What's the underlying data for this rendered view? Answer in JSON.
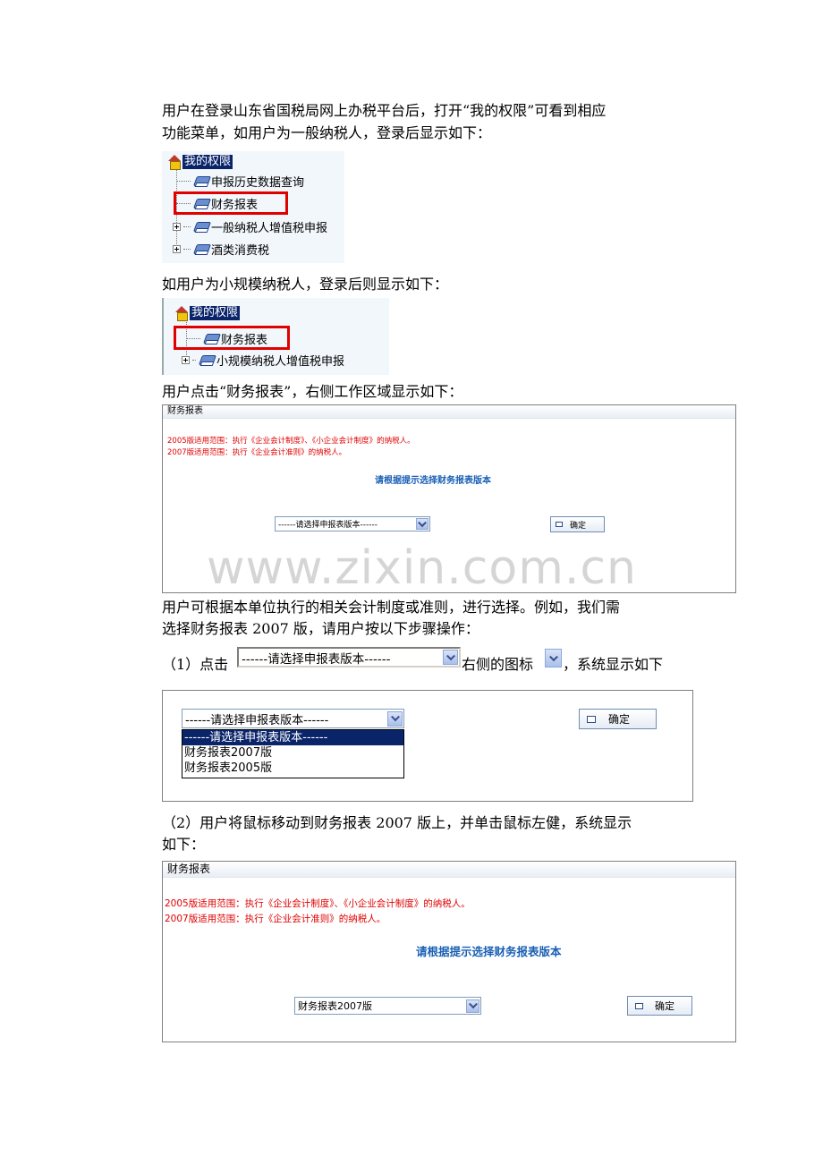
{
  "text": {
    "p1_line1": "用户在登录山东省国税局网上办税平台后，打开“我的权限”可看到相应",
    "p1_line2": "功能菜单，如用户为一般纳税人，登录后显示如下：",
    "p2": "如用户为小规模纳税人，登录后则显示如下：",
    "p3": "用户点击“财务报表”，右侧工作区域显示如下：",
    "p4_line1": "用户可根据本单位执行的相关会计制度或准则，进行选择。例如，我们需",
    "p4_line2": "选择财务报表 2007 版，请用户按以下步骤操作：",
    "step1_prefix": "（1）点击",
    "step1_middle": "右侧的图标",
    "step1_suffix": "，系统显示如下",
    "step2_line1": "（2）用户将鼠标移动到财务报表 2007 版上，并单击鼠标左健，系统显示",
    "step2_line2": "如下："
  },
  "tree1": {
    "root": "我的权限",
    "items": [
      "申报历史数据查询",
      "财务报表",
      "一般纳税人增值税申报",
      "酒类消费税"
    ]
  },
  "tree2": {
    "root": "我的权限",
    "items": [
      "财务报表",
      "小规模纳税人增值税申报"
    ]
  },
  "panel": {
    "title": "财务报表",
    "line_2005": "2005版适用范围：执行《企业会计制度》、《小企业会计制度》的纳税人。",
    "line_2007": "2007版适用范围：执行《企业会计准则》的纳税人。",
    "prompt": "请根据提示选择财务报表版本",
    "select_default": "------请选择申报表版本------",
    "confirm": "确定"
  },
  "dropdown": {
    "options": [
      "------请选择申报表版本------",
      "财务报表2007版",
      "财务报表2005版"
    ]
  },
  "panel_final": {
    "selected": "财务报表2007版"
  },
  "watermark": "www.zixin.com.cn"
}
